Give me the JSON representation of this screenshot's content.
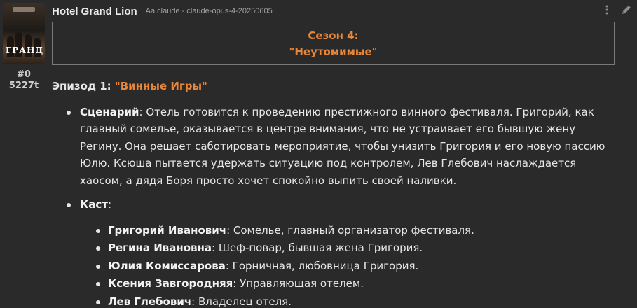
{
  "message": {
    "id": "#0",
    "tokens": "5227t",
    "character_name": "Hotel Grand Lion",
    "model_tag": "Aa claude - claude-opus-4-20250605",
    "avatar_title": "ГРАНД"
  },
  "season": {
    "line1": "Сезон 4:",
    "line2": "\"Неутомимые\""
  },
  "episode": {
    "label": "Эпизод 1: ",
    "title": "\"Винные Игры\""
  },
  "scenario": {
    "label": "Сценарий",
    "text": ": Отель готовится к проведению престижного винного фестиваля. Григорий, как главный сомелье, оказывается в центре внимания, что не устраивает его бывшую жену Регину. Она решает саботировать мероприятие, чтобы унизить Григория и его новую пассию Юлю. Ксюша пытается удержать ситуацию под контролем, Лев Глебович наслаждается хаосом, а дядя Боря просто хочет спокойно выпить своей наливки."
  },
  "cast": {
    "label": "Каст",
    "suffix": ":",
    "members": [
      {
        "name": "Григорий Иванович",
        "role": ": Сомелье, главный организатор фестиваля."
      },
      {
        "name": "Регина Ивановна",
        "role": ": Шеф-повар, бывшая жена Григория."
      },
      {
        "name": "Юлия Комиссарова",
        "role": ": Горничная, любовница Григория."
      },
      {
        "name": "Ксения Завгородняя",
        "role": ": Управляющая отелем."
      },
      {
        "name": "Лев Глебович",
        "role": ": Владелец отеля."
      }
    ]
  },
  "icons": {
    "more": "more-dots-icon",
    "edit": "pencil-icon"
  },
  "colors": {
    "accent": "#e8873a",
    "background": "#2a2a2a",
    "text": "#e6e6e6"
  }
}
